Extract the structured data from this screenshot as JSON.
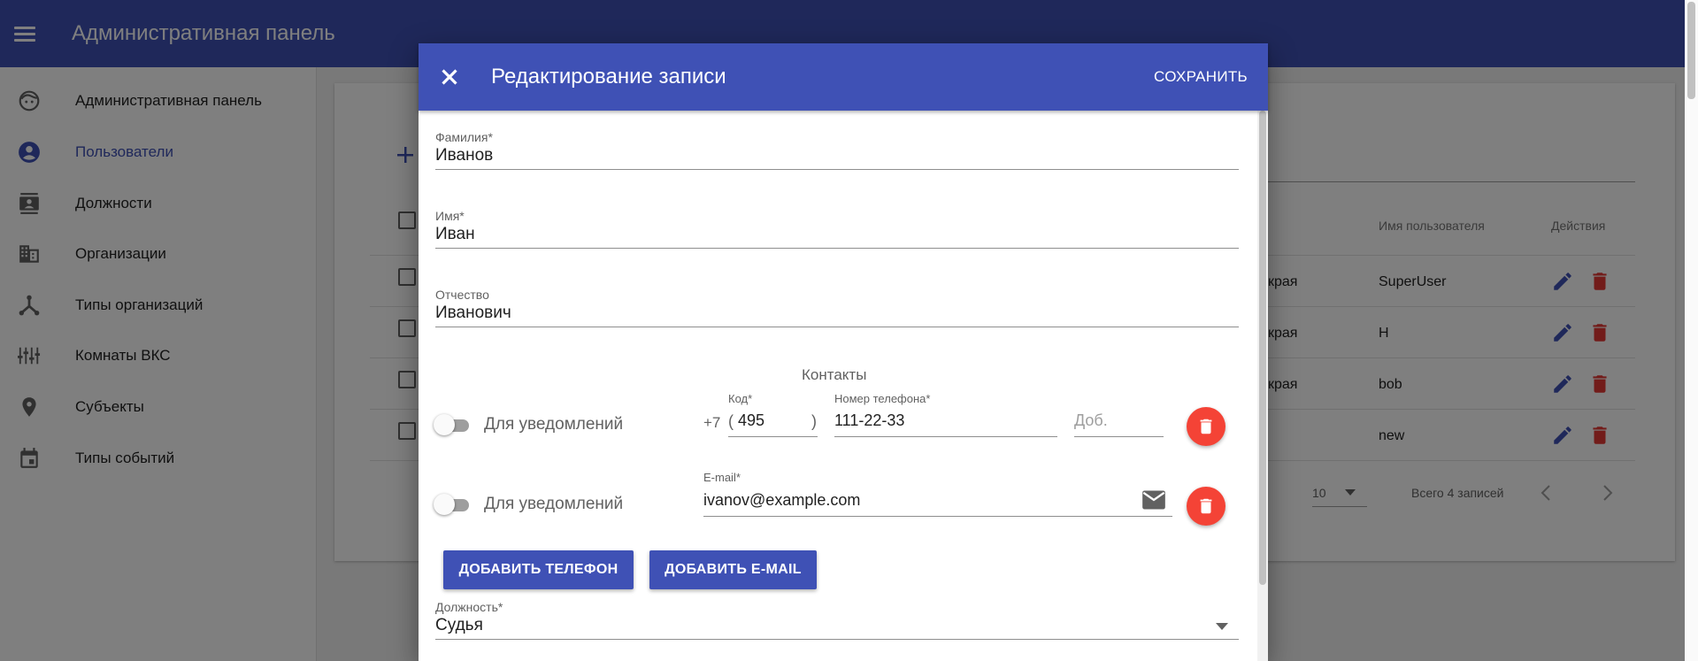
{
  "app": {
    "title": "Административная панель"
  },
  "sidebar": {
    "items": [
      {
        "label": "Административная панель",
        "icon": "face-icon"
      },
      {
        "label": "Пользователи",
        "icon": "account-circle-icon",
        "active": true
      },
      {
        "label": "Должности",
        "icon": "contact-card-icon"
      },
      {
        "label": "Организации",
        "icon": "building-icon"
      },
      {
        "label": "Типы организаций",
        "icon": "hub-icon"
      },
      {
        "label": "Комнаты ВКС",
        "icon": "sliders-icon"
      },
      {
        "label": "Субъекты",
        "icon": "location-pin-icon"
      },
      {
        "label": "Типы событий",
        "icon": "calendar-icon"
      }
    ]
  },
  "table": {
    "headers": {
      "username": "Имя пользователя",
      "actions": "Действия"
    },
    "rows": [
      {
        "partial": "края",
        "username": "SuperUser"
      },
      {
        "partial": "края",
        "username": "H"
      },
      {
        "partial": "края",
        "username": "bob"
      },
      {
        "partial": "",
        "username": "new"
      }
    ],
    "footer": {
      "page_size": "10",
      "total": "Всего 4 записей"
    }
  },
  "dialog": {
    "title": "Редактирование записи",
    "save_label": "СОХРАНИТЬ",
    "fields": {
      "last_name": {
        "label": "Фамилия*",
        "value": "Иванов"
      },
      "first_name": {
        "label": "Имя*",
        "value": "Иван"
      },
      "patronymic": {
        "label": "Отчество",
        "value": "Иванович"
      }
    },
    "contacts": {
      "title": "Контакты",
      "phone": {
        "notify_label": "Для уведомлений",
        "country_code": "+7",
        "code_label": "Код*",
        "code_value": "495",
        "paren_open": "(",
        "paren_close": ")",
        "number_label": "Номер телефона*",
        "number_value": "111-22-33",
        "ext_placeholder": "Доб."
      },
      "email": {
        "notify_label": "Для уведомлений",
        "label": "E-mail*",
        "value": "ivanov@example.com"
      }
    },
    "add_phone_label": "ДОБАВИТЬ ТЕЛЕФОН",
    "add_email_label": "ДОБАВИТЬ E-MAIL",
    "position": {
      "label": "Должность*",
      "value": "Судья"
    }
  },
  "colors": {
    "primary": "#3f51b5",
    "danger": "#f44336",
    "delete_icon": "#e53935"
  }
}
